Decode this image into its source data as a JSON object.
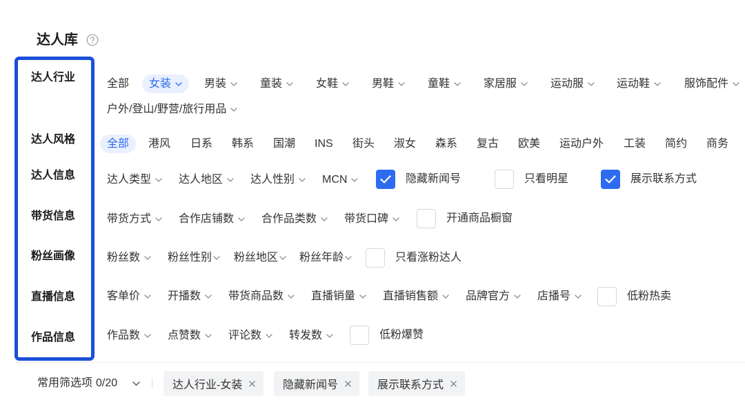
{
  "header": {
    "title": "达人库",
    "help_icon": "question-circle-icon"
  },
  "theme": {
    "accent": "#2d6cf0",
    "highlight_box": "#1b4fd8",
    "selected_bg": "#eaf0fe",
    "chip_bg": "#f2f3f5"
  },
  "filters": {
    "industry": {
      "label": "达人行业",
      "options": [
        {
          "label": "全部",
          "selected": false
        },
        {
          "label": "女装",
          "icon": "chevron-down-icon",
          "selected": true
        },
        {
          "label": "男装",
          "icon": "chevron-down-icon",
          "selected": false
        },
        {
          "label": "童装",
          "icon": "chevron-down-icon",
          "selected": false
        },
        {
          "label": "女鞋",
          "icon": "chevron-down-icon",
          "selected": false
        },
        {
          "label": "男鞋",
          "icon": "chevron-down-icon",
          "selected": false
        },
        {
          "label": "童鞋",
          "icon": "chevron-down-icon",
          "selected": false
        },
        {
          "label": "家居服",
          "icon": "chevron-down-icon",
          "selected": false
        },
        {
          "label": "运动服",
          "icon": "chevron-down-icon",
          "selected": false
        },
        {
          "label": "运动鞋",
          "icon": "chevron-down-icon",
          "selected": false
        },
        {
          "label": "服饰配件",
          "icon": "chevron-down-icon",
          "selected": false
        },
        {
          "label": "户外/登山/野营/旅行用品",
          "icon": "chevron-down-icon",
          "selected": false
        }
      ]
    },
    "style": {
      "label": "达人风格",
      "options": [
        {
          "label": "全部",
          "selected": true
        },
        {
          "label": "港风",
          "selected": false
        },
        {
          "label": "日系",
          "selected": false
        },
        {
          "label": "韩系",
          "selected": false
        },
        {
          "label": "国潮",
          "selected": false
        },
        {
          "label": "INS",
          "selected": false
        },
        {
          "label": "街头",
          "selected": false
        },
        {
          "label": "淑女",
          "selected": false
        },
        {
          "label": "森系",
          "selected": false
        },
        {
          "label": "复古",
          "selected": false
        },
        {
          "label": "欧美",
          "selected": false
        },
        {
          "label": "运动户外",
          "selected": false
        },
        {
          "label": "工装",
          "selected": false
        },
        {
          "label": "简约",
          "selected": false
        },
        {
          "label": "商务",
          "selected": false
        }
      ]
    },
    "creator_info": {
      "label": "达人信息",
      "dropdowns": [
        {
          "label": "达人类型",
          "icon": "chevron-down-icon"
        },
        {
          "label": "达人地区",
          "icon": "chevron-down-icon"
        },
        {
          "label": "达人性别",
          "icon": "chevron-down-icon"
        },
        {
          "label": "MCN",
          "icon": "chevron-down-icon"
        }
      ],
      "checkboxes": [
        {
          "label": "隐藏新闻号",
          "checked": true
        },
        {
          "label": "只看明星",
          "checked": false
        },
        {
          "label": "展示联系方式",
          "checked": true
        }
      ]
    },
    "sales_info": {
      "label": "带货信息",
      "dropdowns": [
        {
          "label": "带货方式",
          "icon": "chevron-down-icon"
        },
        {
          "label": "合作店铺数",
          "icon": "chevron-down-icon"
        },
        {
          "label": "合作品类数",
          "icon": "chevron-down-icon"
        },
        {
          "label": "带货口碑",
          "icon": "chevron-down-icon"
        }
      ],
      "checkboxes": [
        {
          "label": "开通商品橱窗",
          "checked": false
        }
      ]
    },
    "fan_profile": {
      "label": "粉丝画像",
      "dropdowns": [
        {
          "label": "粉丝数",
          "icon": "chevron-down-icon"
        },
        {
          "label": "粉丝性别",
          "icon": "chevron-down-icon"
        },
        {
          "label": "粉丝地区",
          "icon": "chevron-down-icon"
        },
        {
          "label": "粉丝年龄",
          "icon": "chevron-down-icon"
        }
      ],
      "checkboxes": [
        {
          "label": "只看涨粉达人",
          "checked": false
        }
      ]
    },
    "live_info": {
      "label": "直播信息",
      "dropdowns": [
        {
          "label": "客单价",
          "icon": "chevron-down-icon"
        },
        {
          "label": "开播数",
          "icon": "chevron-down-icon"
        },
        {
          "label": "带货商品数",
          "icon": "chevron-down-icon"
        },
        {
          "label": "直播销量",
          "icon": "chevron-down-icon"
        },
        {
          "label": "直播销售额",
          "icon": "chevron-down-icon"
        },
        {
          "label": "品牌官方",
          "icon": "chevron-down-icon"
        },
        {
          "label": "店播号",
          "icon": "chevron-down-icon"
        }
      ],
      "checkboxes": [
        {
          "label": "低粉热卖",
          "checked": false
        }
      ]
    },
    "works_info": {
      "label": "作品信息",
      "dropdowns": [
        {
          "label": "作品数",
          "icon": "chevron-down-icon"
        },
        {
          "label": "点赞数",
          "icon": "chevron-down-icon"
        },
        {
          "label": "评论数",
          "icon": "chevron-down-icon"
        },
        {
          "label": "转发数",
          "icon": "chevron-down-icon"
        }
      ],
      "checkboxes": [
        {
          "label": "低粉爆赞",
          "checked": false
        }
      ]
    }
  },
  "saved_filters": {
    "label": "常用筛选项",
    "count": "0/20",
    "toggle_icon": "chevron-down-icon",
    "chips": [
      {
        "label": "达人行业-女装",
        "remove_icon": "close-icon"
      },
      {
        "label": "隐藏新闻号",
        "remove_icon": "close-icon"
      },
      {
        "label": "展示联系方式",
        "remove_icon": "close-icon"
      }
    ]
  }
}
